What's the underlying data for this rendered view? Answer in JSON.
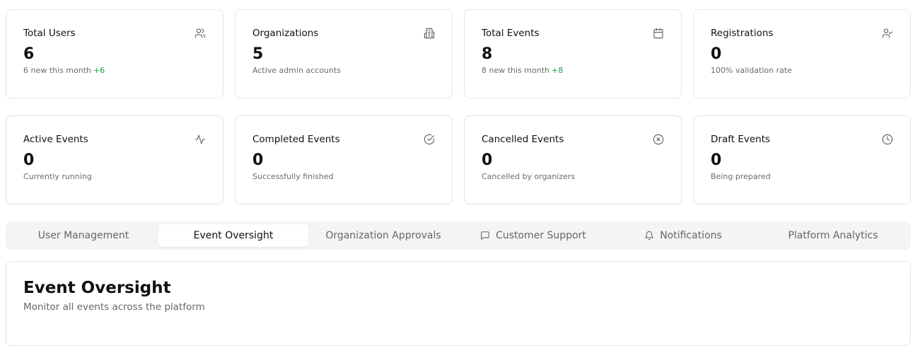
{
  "stats_row1": [
    {
      "title": "Total Users",
      "icon": "users-icon",
      "value": "6",
      "sub": "6 new this month",
      "delta": "+6"
    },
    {
      "title": "Organizations",
      "icon": "building-icon",
      "value": "5",
      "sub": "Active admin accounts",
      "delta": ""
    },
    {
      "title": "Total Events",
      "icon": "calendar-icon",
      "value": "8",
      "sub": "8 new this month",
      "delta": "+8"
    },
    {
      "title": "Registrations",
      "icon": "user-check-icon",
      "value": "0",
      "sub": "100% validation rate",
      "delta": ""
    }
  ],
  "stats_row2": [
    {
      "title": "Active Events",
      "icon": "activity-icon",
      "value": "0",
      "sub": "Currently running"
    },
    {
      "title": "Completed Events",
      "icon": "check-circle-icon",
      "value": "0",
      "sub": "Successfully finished"
    },
    {
      "title": "Cancelled Events",
      "icon": "x-circle-icon",
      "value": "0",
      "sub": "Cancelled by organizers"
    },
    {
      "title": "Draft Events",
      "icon": "clock-icon",
      "value": "0",
      "sub": "Being prepared"
    }
  ],
  "tabs": [
    {
      "label": "User Management",
      "active": false
    },
    {
      "label": "Event Oversight",
      "active": true
    },
    {
      "label": "Organization Approvals",
      "active": false
    },
    {
      "label": "Customer Support",
      "icon": "message-square-icon",
      "active": false
    },
    {
      "label": "Notifications",
      "icon": "bell-icon",
      "active": false
    },
    {
      "label": "Platform Analytics",
      "active": false
    }
  ],
  "panel": {
    "title": "Event Oversight",
    "subtitle": "Monitor all events across the platform"
  },
  "colors": {
    "delta_positive": "#16a34a",
    "border": "#e5e5e5",
    "tabs_bg": "#f4f4f4"
  }
}
